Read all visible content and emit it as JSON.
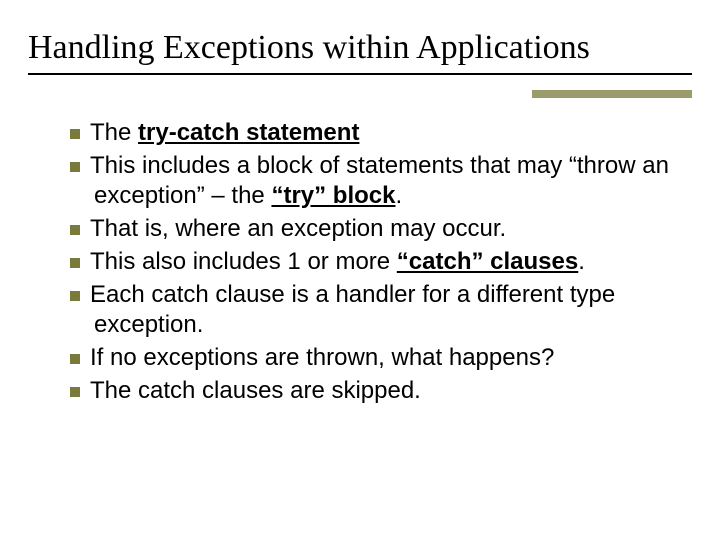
{
  "title": "Handling Exceptions within Applications",
  "lines": [
    {
      "a": "The ",
      "b": "try-catch statement"
    },
    {
      "a": "This includes a block of statements that may “throw an exception” – the ",
      "b": "“try” block",
      "c": "."
    },
    {
      "a": "That is, where an exception may occur."
    },
    {
      "a": "This also includes 1 or more ",
      "b": "“catch” clauses",
      "c": "."
    },
    {
      "a": "Each catch clause is a handler for a different type exception."
    },
    {
      "a": "If no exceptions are thrown, what happens?"
    },
    {
      "a": "The catch clauses are skipped."
    }
  ]
}
